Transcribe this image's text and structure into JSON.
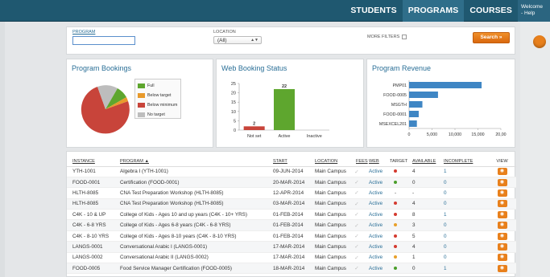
{
  "nav": {
    "tabs": [
      {
        "label": "STUDENTS",
        "active": false
      },
      {
        "label": "PROGRAMS",
        "active": true
      },
      {
        "label": "COURSES",
        "active": false
      }
    ],
    "welcome": "Welcome",
    "help": "- Help"
  },
  "filters": {
    "program_label": "PROGRAM",
    "program_value": "",
    "location_label": "LOCATION",
    "location_value": "(All)",
    "more_filters": "MORE FILTERS",
    "more_filters_checked": false,
    "search_button": "Search »"
  },
  "bookings": {
    "title": "Program Bookings",
    "legend": [
      {
        "label": "Full",
        "color": "#5ea62e"
      },
      {
        "label": "Below target",
        "color": "#e89a2c"
      },
      {
        "label": "Below minimum",
        "color": "#c8443a"
      },
      {
        "label": "No target",
        "color": "#bdbdbd"
      }
    ]
  },
  "status_chart": {
    "title": "Web Booking Status",
    "chart_data": {
      "type": "bar",
      "categories": [
        "Not set",
        "Active",
        "Inactive"
      ],
      "values": [
        2,
        22,
        0
      ],
      "ylim": [
        0,
        25
      ],
      "yticks": [
        "0",
        "5",
        "10",
        "15",
        "20",
        "25"
      ],
      "value_labels": [
        "2",
        "22",
        ""
      ],
      "colors": [
        "#c8443a",
        "#5ea62e",
        "#5ea62e"
      ]
    }
  },
  "revenue_chart": {
    "title": "Program Revenue",
    "chart_data": {
      "type": "bar",
      "orientation": "horizontal",
      "categories": [
        "PMP01",
        "FOOD-0005",
        "MSGTH",
        "FOOD-0001",
        "MSEXCEL201"
      ],
      "values": [
        15800,
        6300,
        2900,
        2100,
        1700
      ],
      "xlim": [
        0,
        20000
      ],
      "xticks": [
        "0",
        "5,000",
        "10,000",
        "15,000",
        "20,00"
      ],
      "color": "#3f86c4"
    }
  },
  "table": {
    "columns": [
      "INSTANCE",
      "PROGRAM ▲",
      "START",
      "LOCATION",
      "FEES",
      "WEB",
      "TARGET",
      "AVAILABLE",
      "INCOMPLETE",
      "VIEW"
    ],
    "rows": [
      {
        "instance": "YTH-1001",
        "program": "Algebra I (YTH-1001)",
        "start": "09-JUN-2014",
        "location": "Main Campus",
        "web": "Active",
        "target": "#d43a2f",
        "available": "4",
        "incomplete": "1"
      },
      {
        "instance": "FOOD-0001",
        "program": "Certification (FOOD-0001)",
        "start": "20-MAR-2014",
        "location": "Main Campus",
        "web": "Active",
        "target": "#4a9e2a",
        "available": "0",
        "incomplete": "0"
      },
      {
        "instance": "HLTH-8085",
        "program": "CNA Test Preparation Workshop (HLTH-8085)",
        "start": "12-APR-2014",
        "location": "Main Campus",
        "web": "Active",
        "target": "",
        "available": "-",
        "incomplete": "0"
      },
      {
        "instance": "HLTH-8085",
        "program": "CNA Test Preparation Workshop (HLTH-8085)",
        "start": "03-MAR-2014",
        "location": "Main Campus",
        "web": "Active",
        "target": "#d43a2f",
        "available": "4",
        "incomplete": "0"
      },
      {
        "instance": "C4K - 10 & UP",
        "program": "College of Kids - Ages 10 and up years (C4K - 10+ YRS)",
        "start": "01-FEB-2014",
        "location": "Main Campus",
        "web": "Active",
        "target": "#d43a2f",
        "available": "8",
        "incomplete": "1"
      },
      {
        "instance": "C4K - 6-8 YRS",
        "program": "College of Kids - Ages 6-8 years (C4K - 6-8 YRS)",
        "start": "01-FEB-2014",
        "location": "Main Campus",
        "web": "Active",
        "target": "#e8a02a",
        "available": "3",
        "incomplete": "0"
      },
      {
        "instance": "C4K - 8-10 YRS",
        "program": "College of Kids - Ages 8-10 years (C4K - 8-10 YRS)",
        "start": "01-FEB-2014",
        "location": "Main Campus",
        "web": "Active",
        "target": "#d43a2f",
        "available": "5",
        "incomplete": "0"
      },
      {
        "instance": "LANGS-0001",
        "program": "Conversational Arabic I (LANGS-0001)",
        "start": "17-MAR-2014",
        "location": "Main Campus",
        "web": "Active",
        "target": "#d43a2f",
        "available": "4",
        "incomplete": "0"
      },
      {
        "instance": "LANGS-0002",
        "program": "Conversational Arabic II (LANGS-0002)",
        "start": "17-MAR-2014",
        "location": "Main Campus",
        "web": "Active",
        "target": "#e8a02a",
        "available": "1",
        "incomplete": "0"
      },
      {
        "instance": "FOOD-0005",
        "program": "Food Service Manager Certification (FOOD-0005)",
        "start": "18-MAR-2014",
        "location": "Main Campus",
        "web": "Active",
        "target": "#4a9e2a",
        "available": "0",
        "incomplete": "1"
      }
    ]
  }
}
